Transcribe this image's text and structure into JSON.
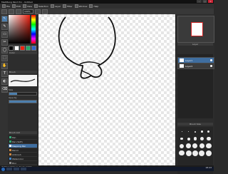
{
  "window": {
    "title": "MediBang Paint Pro - Untitled",
    "minimize": "–",
    "maximize": "□",
    "close": "✕"
  },
  "menu": [
    {
      "label": "File"
    },
    {
      "label": "Edit"
    },
    {
      "label": "View"
    },
    {
      "label": "Selection"
    },
    {
      "label": "Layer"
    },
    {
      "label": "Filter"
    },
    {
      "label": "Window"
    },
    {
      "label": "Help"
    }
  ],
  "toolbar": {
    "zoom_value": "100%"
  },
  "tools": [
    "↖",
    "✎",
    "▭",
    "✂",
    "◯",
    "⬚",
    "✋",
    "T",
    "◐",
    "⌫"
  ],
  "left_panel": {
    "color_title": "Color",
    "brush_title": "Brush",
    "size_label": "Size",
    "opacity_label": "Opacity",
    "size_fraction": 0.28,
    "opacity_fraction": 1.0,
    "layers_title": "Brush List",
    "brush_items": [
      "Pen",
      "Pen (Soft)",
      "Mapping Pen",
      "Pencil",
      "Airbrush",
      "Watercolor",
      "Blur"
    ]
  },
  "right_panel": {
    "navigator_title": "Navigator",
    "layer_title": "Layer",
    "layers": [
      "Layer1",
      "Layer2"
    ],
    "brush_panel_title": "Brush Size"
  },
  "status": {
    "text": "3180 * 1500 px  72 dpi  100%",
    "clock": "18:43"
  },
  "colors": {
    "accent": "#4d7fae",
    "selected_layer": "#3f6ea0"
  }
}
